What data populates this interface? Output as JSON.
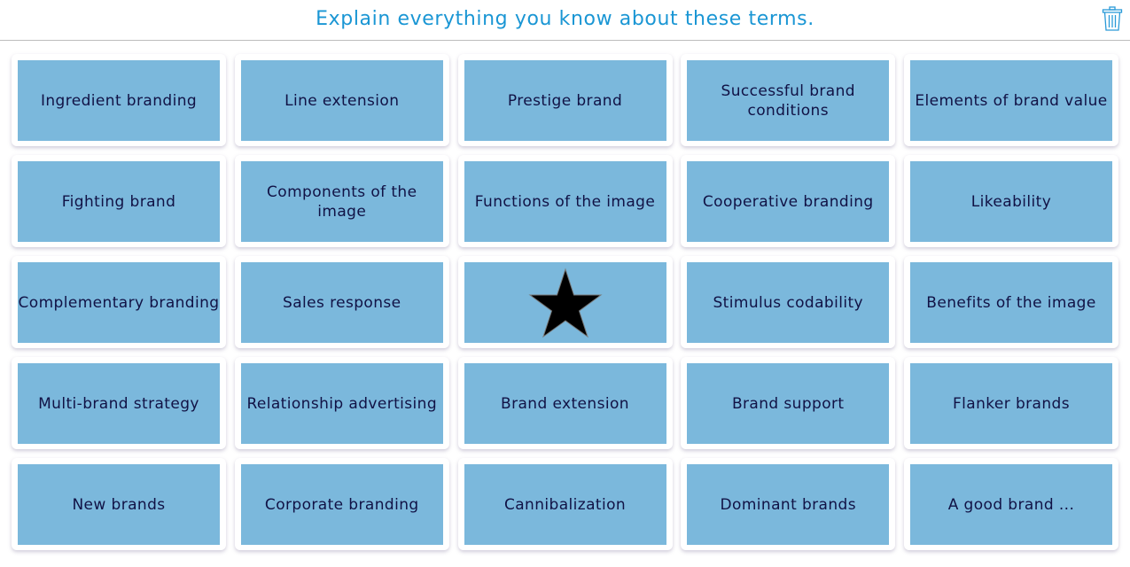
{
  "header": {
    "title": "Explain everything you know about these terms.",
    "trash_icon": "trash-icon",
    "accent_color": "#1a96d4"
  },
  "tile_color": "#7bb8dc",
  "text_color": "#111245",
  "cards": [
    {
      "label": "Ingredient branding"
    },
    {
      "label": "Line extension"
    },
    {
      "label": "Prestige brand"
    },
    {
      "label": "Successful brand\nconditions"
    },
    {
      "label": "Elements of brand value"
    },
    {
      "label": "Fighting brand"
    },
    {
      "label": "Components of the image"
    },
    {
      "label": "Functions of the image"
    },
    {
      "label": "Cooperative branding"
    },
    {
      "label": "Likeability"
    },
    {
      "label": "Complementary branding"
    },
    {
      "label": "Sales response"
    },
    {
      "label": "",
      "icon": "star-icon"
    },
    {
      "label": "Stimulus codability"
    },
    {
      "label": "Benefits of the image"
    },
    {
      "label": "Multi-brand strategy"
    },
    {
      "label": "Relationship advertising"
    },
    {
      "label": "Brand extension"
    },
    {
      "label": "Brand support"
    },
    {
      "label": "Flanker brands"
    },
    {
      "label": "New brands"
    },
    {
      "label": "Corporate branding"
    },
    {
      "label": "Cannibalization"
    },
    {
      "label": "Dominant brands"
    },
    {
      "label": "A good brand ..."
    }
  ]
}
